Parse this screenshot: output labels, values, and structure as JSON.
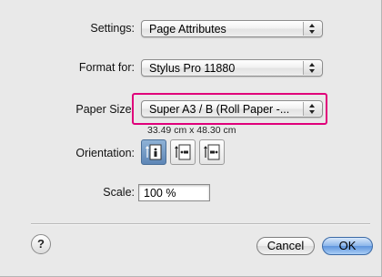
{
  "settings": {
    "label": "Settings:",
    "value": "Page Attributes"
  },
  "format_for": {
    "label": "Format for:",
    "value": "Stylus Pro 11880"
  },
  "paper_size": {
    "label": "Paper Size:",
    "value": "Super A3 / B (Roll Paper -...",
    "dimensions": "33.49 cm x 48.30 cm",
    "highlight_color": "#e0007a"
  },
  "orientation": {
    "label": "Orientation:",
    "options": [
      "portrait",
      "landscape-left",
      "landscape-right"
    ],
    "selected": "portrait"
  },
  "scale": {
    "label": "Scale:",
    "value": "100 %"
  },
  "help": {
    "label": "?"
  },
  "buttons": {
    "cancel": "Cancel",
    "ok": "OK"
  }
}
